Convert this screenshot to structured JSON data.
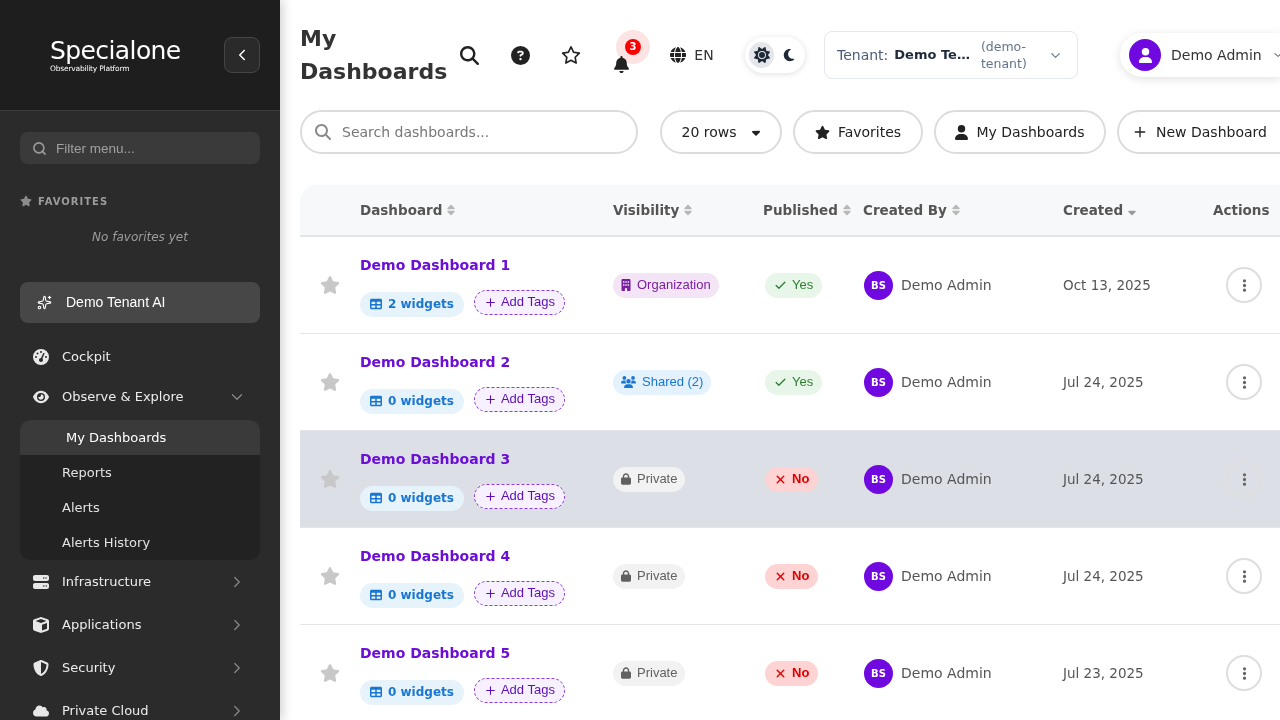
{
  "sidebar": {
    "logo": {
      "wordmark": "Specialone",
      "tagline": "Observability Platform"
    },
    "filter": {
      "placeholder": "Filter menu..."
    },
    "favorites": {
      "heading": "FAVORITES",
      "empty_text": "No favorites yet"
    },
    "assistant": {
      "label": "Demo Tenant AI"
    },
    "nav": [
      {
        "label": "Cockpit",
        "kind": "link"
      },
      {
        "label": "Observe & Explore",
        "kind": "group",
        "expanded": true,
        "children": [
          {
            "label": "My Dashboards",
            "selected": true
          },
          {
            "label": "Reports",
            "selected": false
          },
          {
            "label": "Alerts",
            "selected": false
          },
          {
            "label": "Alerts History",
            "selected": false
          }
        ]
      },
      {
        "label": "Infrastructure",
        "kind": "group",
        "expanded": false
      },
      {
        "label": "Applications",
        "kind": "group",
        "expanded": false
      },
      {
        "label": "Security",
        "kind": "group",
        "expanded": false
      },
      {
        "label": "Private Cloud",
        "kind": "group",
        "expanded": false
      }
    ]
  },
  "header": {
    "title": "My Dashboards",
    "notifications": {
      "count": "3"
    },
    "language": "EN",
    "theme_options": [
      {
        "kind": "light",
        "selected": true
      },
      {
        "kind": "dark",
        "selected": false
      }
    ],
    "tenant": {
      "label": "Tenant:",
      "name": "Demo Te…",
      "slug": "(demo-tenant)"
    },
    "user": {
      "name": "Demo Admin"
    }
  },
  "toolbar": {
    "search": {
      "placeholder": "Search dashboards..."
    },
    "page_size": "20 rows",
    "buttons": [
      {
        "kind": "favorites",
        "label": "Favorites"
      },
      {
        "kind": "mine",
        "label": "My Dashboards"
      },
      {
        "kind": "create",
        "label": "New Dashboard"
      }
    ]
  },
  "table": {
    "columns": [
      {
        "label": "Dashboard",
        "sortable": true,
        "sorted": false
      },
      {
        "label": "Visibility",
        "sortable": true,
        "sorted": false
      },
      {
        "label": "Published",
        "sortable": true,
        "sorted": false
      },
      {
        "label": "Created By",
        "sortable": true,
        "sorted": false
      },
      {
        "label": "Created",
        "sortable": true,
        "sorted": true
      },
      {
        "label": "Actions",
        "sortable": false
      }
    ],
    "rows": [
      {
        "favorite": false,
        "highlighted": false,
        "name": "Demo Dashboard 1",
        "widgets": "2 widgets",
        "add_tags": "Add Tags",
        "visibility": {
          "kind": "organization",
          "label": "Organization"
        },
        "published": {
          "value": true,
          "label": "Yes"
        },
        "created_by": {
          "initials": "BS",
          "name": "Demo Admin"
        },
        "created": "Oct 13, 2025"
      },
      {
        "favorite": false,
        "highlighted": false,
        "name": "Demo Dashboard 2",
        "widgets": "0 widgets",
        "add_tags": "Add Tags",
        "visibility": {
          "kind": "shared",
          "label": "Shared (2)"
        },
        "published": {
          "value": true,
          "label": "Yes"
        },
        "created_by": {
          "initials": "BS",
          "name": "Demo Admin"
        },
        "created": "Jul 24, 2025"
      },
      {
        "favorite": false,
        "highlighted": true,
        "name": "Demo Dashboard 3",
        "widgets": "0 widgets",
        "add_tags": "Add Tags",
        "visibility": {
          "kind": "private",
          "label": "Private"
        },
        "published": {
          "value": false,
          "label": "No"
        },
        "created_by": {
          "initials": "BS",
          "name": "Demo Admin"
        },
        "created": "Jul 24, 2025"
      },
      {
        "favorite": false,
        "highlighted": false,
        "name": "Demo Dashboard 4",
        "widgets": "0 widgets",
        "add_tags": "Add Tags",
        "visibility": {
          "kind": "private",
          "label": "Private"
        },
        "published": {
          "value": false,
          "label": "No"
        },
        "created_by": {
          "initials": "BS",
          "name": "Demo Admin"
        },
        "created": "Jul 24, 2025"
      },
      {
        "favorite": false,
        "highlighted": false,
        "name": "Demo Dashboard 5",
        "widgets": "0 widgets",
        "add_tags": "Add Tags",
        "visibility": {
          "kind": "private",
          "label": "Private"
        },
        "published": {
          "value": false,
          "label": "No"
        },
        "created_by": {
          "initials": "BS",
          "name": "Demo Admin"
        },
        "created": "Jul 23, 2025"
      }
    ]
  }
}
